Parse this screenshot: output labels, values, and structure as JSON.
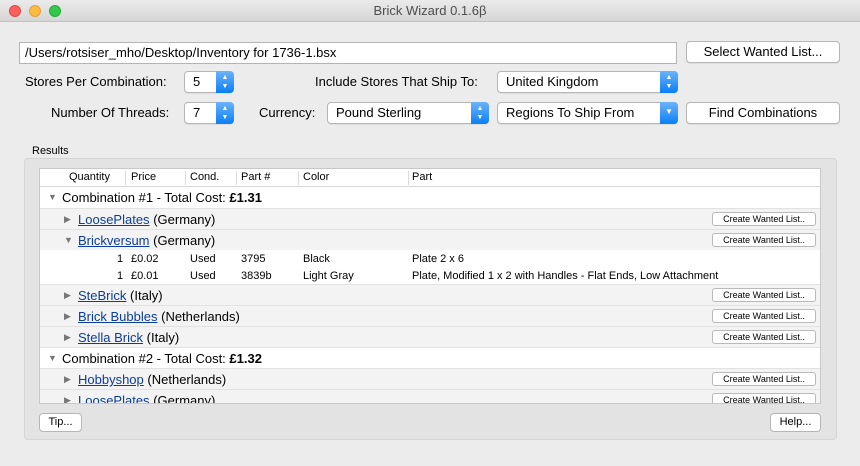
{
  "window": {
    "title": "Brick Wizard 0.1.6β"
  },
  "inventory_path": "/Users/rotsiser_mho/Desktop/Inventory for 1736-1.bsx",
  "buttons": {
    "select_wanted_list": "Select Wanted List...",
    "find_combinations": "Find Combinations",
    "tip": "Tip...",
    "help": "Help..."
  },
  "form": {
    "stores_per_combination_label": "Stores Per Combination:",
    "stores_per_combination_value": "5",
    "number_of_threads_label": "Number Of Threads:",
    "number_of_threads_value": "7",
    "include_stores_label": "Include Stores That Ship To:",
    "include_stores_value": "United Kingdom",
    "currency_label": "Currency:",
    "currency_value": "Pound Sterling",
    "regions_value": "Regions To Ship From"
  },
  "results": {
    "label": "Results",
    "columns": [
      "Quantity",
      "Price",
      "Cond.",
      "Part #",
      "Color",
      "Part"
    ],
    "create_wanted_list_label": "Create Wanted List..",
    "combination_1": {
      "title": "Combination #1 - Total Cost: ",
      "cost": "£1.31"
    },
    "combination_2": {
      "title": "Combination #2 - Total Cost: ",
      "cost": "£1.32"
    },
    "stores": [
      {
        "name": "LoosePlates",
        "country": "(Germany)"
      },
      {
        "name": "Brickversum",
        "country": "(Germany)"
      },
      {
        "name": "SteBrick",
        "country": "(Italy)"
      },
      {
        "name": "Brick Bubbles",
        "country": "(Netherlands)"
      },
      {
        "name": "Stella Brick",
        "country": "(Italy)"
      },
      {
        "name": "Hobbyshop",
        "country": "(Netherlands)"
      },
      {
        "name": "LoosePlates",
        "country": "(Germany)"
      }
    ],
    "parts": [
      {
        "quantity": "1",
        "price": "£0.02",
        "cond": "Used",
        "part_no": "3795",
        "color": "Black",
        "part": "Plate 2 x 6"
      },
      {
        "quantity": "1",
        "price": "£0.01",
        "cond": "Used",
        "part_no": "3839b",
        "color": "Light Gray",
        "part": "Plate, Modified 1 x 2 with Handles - Flat Ends, Low Attachment"
      }
    ]
  }
}
